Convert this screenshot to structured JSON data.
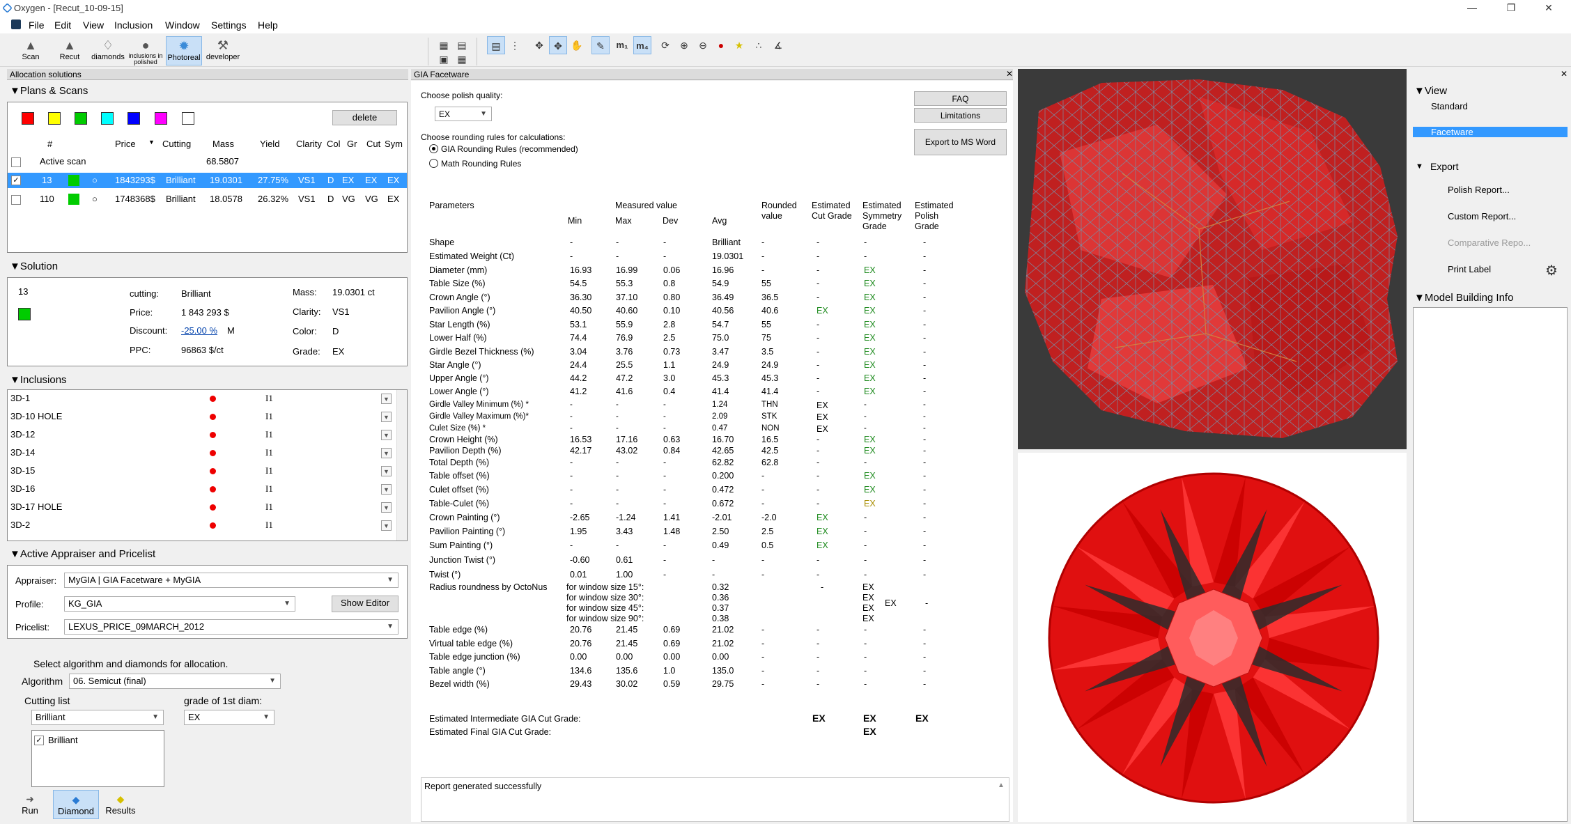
{
  "window": {
    "title": "Oxygen - [Recut_10-09-15]"
  },
  "menu": [
    "File",
    "Edit",
    "View",
    "Inclusion",
    "Window",
    "Settings",
    "Help"
  ],
  "toolbar": [
    {
      "label": "Scan",
      "icon": "scan-icon"
    },
    {
      "label": "Recut",
      "icon": "recut-icon"
    },
    {
      "label": "diamonds",
      "icon": "diamond-icon"
    },
    {
      "label": "inclusions in polished",
      "icon": "inclusions-icon"
    },
    {
      "label": "Photoreal",
      "icon": "photoreal-icon"
    },
    {
      "label": "developer",
      "icon": "hammer-icon"
    }
  ],
  "left": {
    "header": "Allocation solutions",
    "plans": {
      "title": "Plans & Scans",
      "swatches": [
        "#ff0000",
        "#ffff00",
        "#00cc00",
        "#00ffff",
        "#0000ff",
        "#ff00ff",
        "#ffffff"
      ],
      "delete_label": "delete",
      "columns": [
        "#",
        "Price",
        "Cutting",
        "Mass",
        "Yield",
        "Clarity",
        "Col",
        "Gr",
        "Cut",
        "Sym"
      ],
      "active_scan": {
        "label": "Active scan",
        "mass": "68.5807"
      },
      "rows": [
        {
          "num": "13",
          "color": "#00cc00",
          "price": "1843293$",
          "cutting": "Brilliant",
          "mass": "19.0301",
          "yield": "27.75%",
          "clarity": "VS1",
          "col": "D",
          "gr": "EX",
          "cut": "EX",
          "sym": "EX",
          "selected": true,
          "checked": "✓"
        },
        {
          "num": "110",
          "color": "#00cc00",
          "price": "1748368$",
          "cutting": "Brilliant",
          "mass": "18.0578",
          "yield": "26.32%",
          "clarity": "VS1",
          "col": "D",
          "gr": "VG",
          "cut": "VG",
          "sym": "EX",
          "selected": false,
          "checked": ""
        }
      ]
    },
    "solution": {
      "title": "Solution",
      "num": "13",
      "color": "#00cc00",
      "cutting_label": "cutting:",
      "cutting": "Brilliant",
      "price_label": "Price:",
      "price": "1 843 293 $",
      "discount_label": "Discount:",
      "discount": "-25.00 %",
      "discount_unit": "M",
      "ppc_label": "PPC:",
      "ppc": "96863 $/ct",
      "mass_label": "Mass:",
      "mass": "19.0301 ct",
      "clarity_label": "Clarity:",
      "clarity": "VS1",
      "color_label": "Color:",
      "color_val": "D",
      "grade_label": "Grade:",
      "grade": "EX"
    },
    "inclusions": {
      "title": "Inclusions",
      "items": [
        {
          "name": "3D-1",
          "grade": "I1"
        },
        {
          "name": "3D-10 HOLE",
          "grade": "I1"
        },
        {
          "name": "3D-12",
          "grade": "I1"
        },
        {
          "name": "3D-14",
          "grade": "I1"
        },
        {
          "name": "3D-15",
          "grade": "I1"
        },
        {
          "name": "3D-16",
          "grade": "I1"
        },
        {
          "name": "3D-17 HOLE",
          "grade": "I1"
        },
        {
          "name": "3D-2",
          "grade": "I1"
        }
      ]
    },
    "appraiser": {
      "title": "Active Appraiser and Pricelist",
      "appraiser_label": "Appraiser:",
      "appraiser": "MyGIA | GIA Facetware + MyGIA",
      "profile_label": "Profile:",
      "profile": "KG_GIA",
      "show_editor": "Show Editor",
      "pricelist_label": "Pricelist:",
      "pricelist": "LEXUS_PRICE_09MARCH_2012"
    },
    "algo": {
      "prompt": "Select algorithm and diamonds for allocation.",
      "algorithm_label": "Algorithm",
      "algorithm": "06. Semicut (final)",
      "cutting_list_label": "Cutting list",
      "cutting_list": "Brilliant",
      "grade_label": "grade of 1st diam:",
      "grade": "EX",
      "brilliant_check": "Brilliant"
    },
    "bottom_tabs": [
      {
        "label": "Run"
      },
      {
        "label": "Diamond"
      },
      {
        "label": "Results"
      }
    ]
  },
  "gia": {
    "header": "GIA Facetware",
    "polish_label": "Choose polish quality:",
    "polish": "EX",
    "rounding_label": "Choose rounding rules for calculations:",
    "rounding_options": [
      "GIA Rounding Rules (recommended)",
      "Math Rounding Rules"
    ],
    "faq": "FAQ",
    "limitations": "Limitations",
    "export": "Export to MS Word",
    "col_headers": {
      "params": "Parameters",
      "measured": "Measured value",
      "min": "Min",
      "max": "Max",
      "dev": "Dev",
      "avg": "Avg",
      "rounded": "Rounded value",
      "cut": "Estimated Cut Grade",
      "sym": "Estimated Symmetry Grade",
      "pol": "Estimated Polish Grade"
    },
    "rows": [
      [
        "Shape",
        "-",
        "-",
        "-",
        "Brilliant",
        "-",
        "-",
        "-",
        "-"
      ],
      [
        "Estimated Weight (Ct)",
        "-",
        "-",
        "-",
        "19.0301",
        "-",
        "-",
        "-",
        "-"
      ],
      [
        "Diameter (mm)",
        "16.93",
        "16.99",
        "0.06",
        "16.96",
        "-",
        "-",
        "EX",
        "-"
      ],
      [
        "Table Size (%)",
        "54.5",
        "55.3",
        "0.8",
        "54.9",
        "55",
        "-",
        "EX",
        "-"
      ],
      [
        "Crown Angle (°)",
        "36.30",
        "37.10",
        "0.80",
        "36.49",
        "36.5",
        "-",
        "EX",
        "-"
      ],
      [
        "Pavilion Angle (°)",
        "40.50",
        "40.60",
        "0.10",
        "40.56",
        "40.6",
        "EX",
        "EX",
        "-"
      ],
      [
        "Star Length (%)",
        "53.1",
        "55.9",
        "2.8",
        "54.7",
        "55",
        "-",
        "EX",
        "-"
      ],
      [
        "Lower Half (%)",
        "74.4",
        "76.9",
        "2.5",
        "75.0",
        "75",
        "-",
        "EX",
        "-"
      ],
      [
        "Girdle Bezel Thickness (%)",
        "3.04",
        "3.76",
        "0.73",
        "3.47",
        "3.5",
        "-",
        "EX",
        "-"
      ],
      [
        "Star Angle (°)",
        "24.4",
        "25.5",
        "1.1",
        "24.9",
        "24.9",
        "-",
        "EX",
        "-"
      ],
      [
        "Upper Angle (°)",
        "44.2",
        "47.2",
        "3.0",
        "45.3",
        "45.3",
        "-",
        "EX",
        "-"
      ],
      [
        "Lower Angle (°)",
        "41.2",
        "41.6",
        "0.4",
        "41.4",
        "41.4",
        "-",
        "EX",
        "-"
      ],
      [
        "Girdle Valley Minimum (%) *",
        "-",
        "-",
        "-",
        "1.24",
        "THN",
        "EX",
        "-",
        "-"
      ],
      [
        "Girdle Valley Maximum (%)*",
        "-",
        "-",
        "-",
        "2.09",
        "STK",
        "EX",
        "-",
        "-"
      ],
      [
        "Culet Size (%) *",
        "-",
        "-",
        "-",
        "0.47",
        "NON",
        "EX",
        "-",
        "-"
      ],
      [
        "Crown Height (%)",
        "16.53",
        "17.16",
        "0.63",
        "16.70",
        "16.5",
        "-",
        "EX",
        "-"
      ],
      [
        "Pavilion Depth (%)",
        "42.17",
        "43.02",
        "0.84",
        "42.65",
        "42.5",
        "-",
        "EX",
        "-"
      ],
      [
        "Total Depth (%)",
        "-",
        "-",
        "-",
        "62.82",
        "62.8",
        "-",
        "-",
        "-"
      ],
      [
        "Table offset (%)",
        "-",
        "-",
        "-",
        "0.200",
        "-",
        "-",
        "EX",
        "-"
      ],
      [
        "Culet offset (%)",
        "-",
        "-",
        "-",
        "0.472",
        "-",
        "-",
        "EX",
        "-"
      ],
      [
        "Table-Culet (%)",
        "-",
        "-",
        "-",
        "0.672",
        "-",
        "-",
        "EX",
        "-"
      ],
      [
        "Crown Painting (°)",
        "-2.65",
        "-1.24",
        "1.41",
        "-2.01",
        "-2.0",
        "EX",
        "-",
        "-"
      ],
      [
        "Pavilion Painting (°)",
        "1.95",
        "3.43",
        "1.48",
        "2.50",
        "2.5",
        "EX",
        "-",
        "-"
      ],
      [
        "Sum Painting (°)",
        "-",
        "-",
        "-",
        "0.49",
        "0.5",
        "EX",
        "-",
        "-"
      ],
      [
        "Junction Twist (°)",
        "-0.60",
        "0.61",
        "-",
        "-",
        "-",
        "-",
        "-",
        "-"
      ],
      [
        "Twist (°)",
        "0.01",
        "1.00",
        "-",
        "-",
        "-",
        "-",
        "-",
        "-"
      ]
    ],
    "radius": {
      "label": "Radius roundness by OctoNus",
      "windows": [
        "for window size 15°:",
        "for window size 30°:",
        "for window size 45°:",
        "for window size 90°:"
      ],
      "values": [
        "0.32",
        "0.36",
        "0.37",
        "0.38"
      ],
      "cut": "-",
      "sym": [
        "EX",
        "EX",
        "EX",
        "EX"
      ],
      "sym_total": "EX",
      "pol": "-"
    },
    "rows2": [
      [
        "Table edge (%)",
        "20.76",
        "21.45",
        "0.69",
        "21.02",
        "-",
        "-",
        "-",
        "-"
      ],
      [
        "Virtual table edge (%)",
        "20.76",
        "21.45",
        "0.69",
        "21.02",
        "-",
        "-",
        "-",
        "-"
      ],
      [
        "Table edge junction (%)",
        "0.00",
        "0.00",
        "0.00",
        "0.00",
        "-",
        "-",
        "-",
        "-"
      ],
      [
        "Table angle (°)",
        "134.6",
        "135.6",
        "1.0",
        "135.0",
        "-",
        "-",
        "-",
        "-"
      ],
      [
        "Bezel width (%)",
        "29.43",
        "30.02",
        "0.59",
        "29.75",
        "-",
        "-",
        "-",
        "-"
      ]
    ],
    "intermediate_label": "Estimated Intermediate GIA Cut Grade:",
    "final_label": "Estimated Final GIA Cut Grade:",
    "intermediate": [
      "EX",
      "EX",
      "EX"
    ],
    "final": "EX",
    "status": "Report generated successfully"
  },
  "right": {
    "view_title": "View",
    "standard": "Standard",
    "facetware": "Facetware",
    "export_title": "Export",
    "polish_report": "Polish Report...",
    "custom_report": "Custom Report...",
    "comparative": "Comparative Repo...",
    "print_label": "Print Label",
    "model_title": "Model Building Info"
  }
}
